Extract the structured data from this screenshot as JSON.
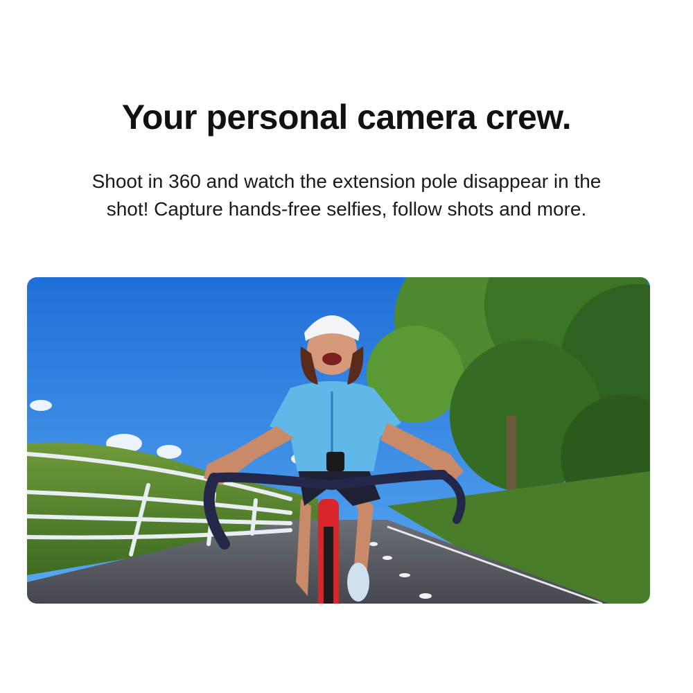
{
  "heading": "Your personal camera crew.",
  "subtitle_line1": "Shoot in 360 and watch the extension pole disappear in the",
  "subtitle_line2": "shot! Capture hands-free selfies, follow shots and more.",
  "photo": {
    "subject": "Smiling cyclist in a blue jersey and white helmet riding a red road bike on a bike path beside trees and a white railing"
  },
  "colors": {
    "sky": "#2f86e6",
    "trees": "#3f7a2a",
    "jersey": "#5fb8e8",
    "bike": "#d8242b",
    "road": "#585c63"
  }
}
